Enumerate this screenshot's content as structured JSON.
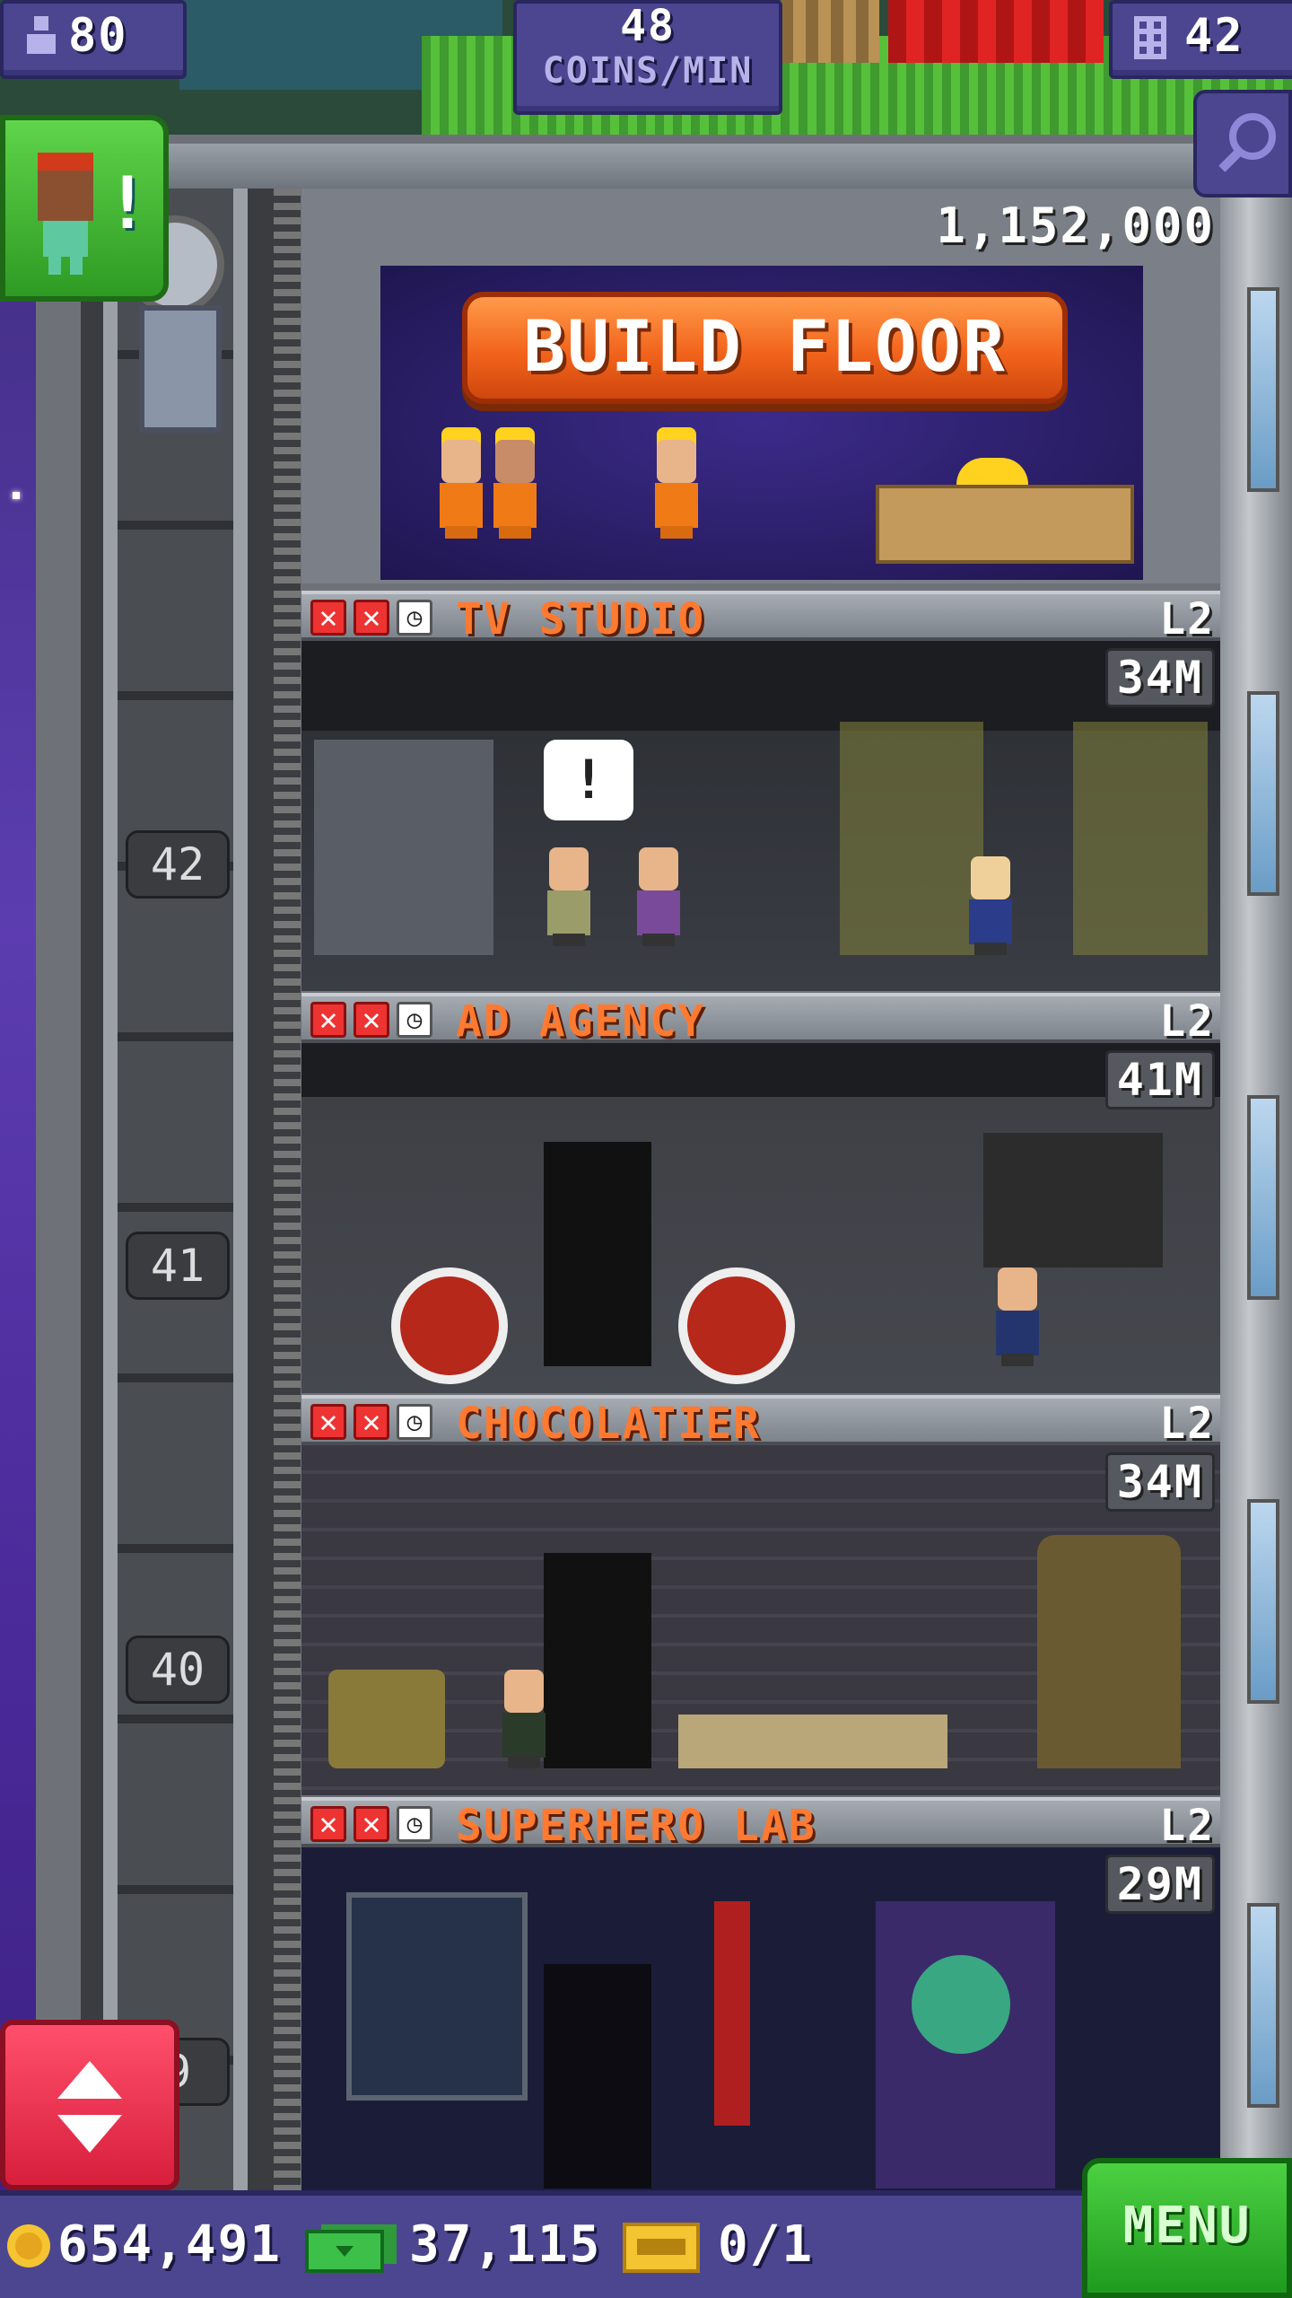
{
  "hud": {
    "population": "80",
    "coins_per_min_value": "48",
    "coins_per_min_label": "COINS/MIN",
    "floors": "42"
  },
  "build_floor": {
    "cost": "1,152,000",
    "label": "BUILD FLOOR"
  },
  "floors": [
    {
      "name": "TV STUDIO",
      "level": "L2",
      "money": "34M",
      "number": "42"
    },
    {
      "name": "AD AGENCY",
      "level": "L2",
      "money": "41M",
      "number": "41"
    },
    {
      "name": "CHOCOLATIER",
      "level": "L2",
      "money": "34M",
      "number": "40"
    },
    {
      "name": "SUPERHERO LAB",
      "level": "L2",
      "money": "29M",
      "number": "9"
    }
  ],
  "notification": {
    "mark": "!"
  },
  "bottom": {
    "coins": "654,491",
    "bux": "37,115",
    "tickets": "0/1",
    "menu_label": "MENU"
  },
  "colors": {
    "accent": "#ff7a30",
    "hud": "#4c4690",
    "menu": "#2fb52a",
    "scroll": "#e3304c"
  },
  "icons": [
    "person-icon",
    "floors-icon",
    "zoom-icon",
    "x-icon",
    "clock-icon",
    "coin-icon",
    "bux-icon",
    "ticket-icon",
    "up-down-icon"
  ]
}
